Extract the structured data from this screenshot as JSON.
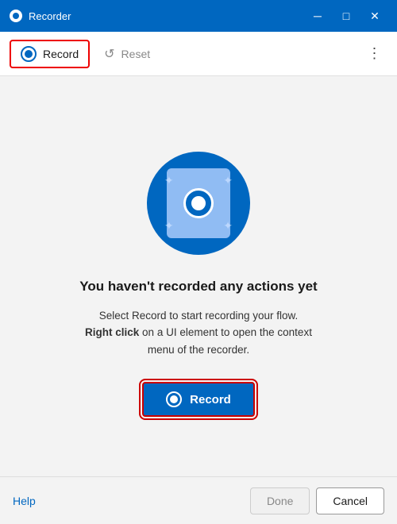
{
  "window": {
    "title": "Recorder"
  },
  "titlebar": {
    "title": "Recorder",
    "minimize_label": "─",
    "restore_label": "□",
    "close_label": "✕"
  },
  "toolbar": {
    "record_label": "Record",
    "reset_label": "Reset",
    "more_label": "⋮"
  },
  "main": {
    "heading": "You haven't recorded any actions yet",
    "description_line1": "Select Record to start recording your flow.",
    "description_bold": "Right click",
    "description_line2": " on a UI element to open the context menu of the recorder.",
    "record_button_label": "Record"
  },
  "footer": {
    "help_label": "Help",
    "done_label": "Done",
    "cancel_label": "Cancel"
  },
  "sparkles": [
    "✦",
    "✦",
    "✦",
    "✦"
  ]
}
